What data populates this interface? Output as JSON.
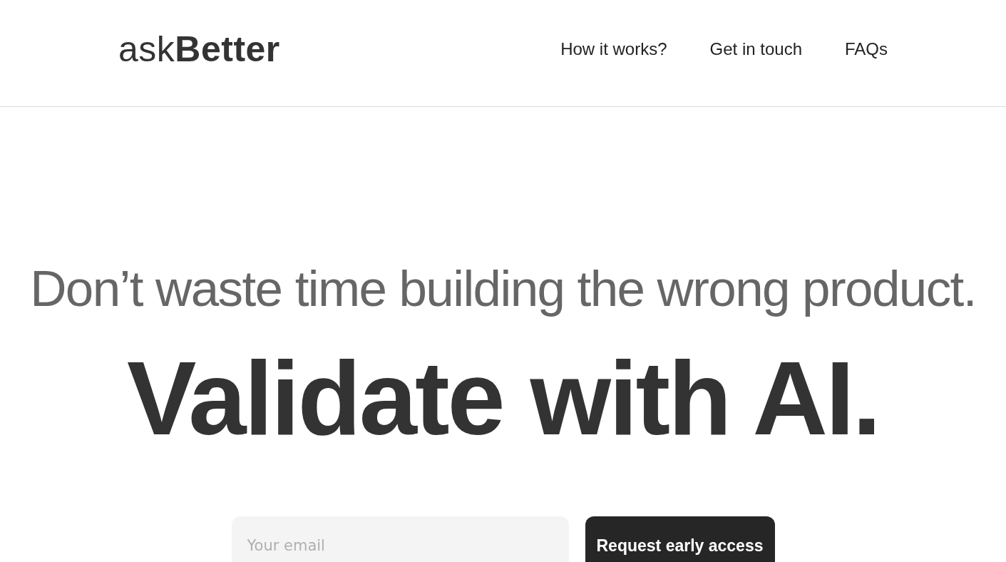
{
  "header": {
    "logo": "ask**Better**",
    "nav": [
      "How it works?",
      "Get in touch",
      "FAQs"
    ]
  },
  "hero": {
    "tagline": "Don’t waste time building the wrong product.",
    "headline": "Validate with AI."
  },
  "signup": {
    "email": {
      "placeholder": "Your email"
    },
    "button": "Request early access"
  }
}
